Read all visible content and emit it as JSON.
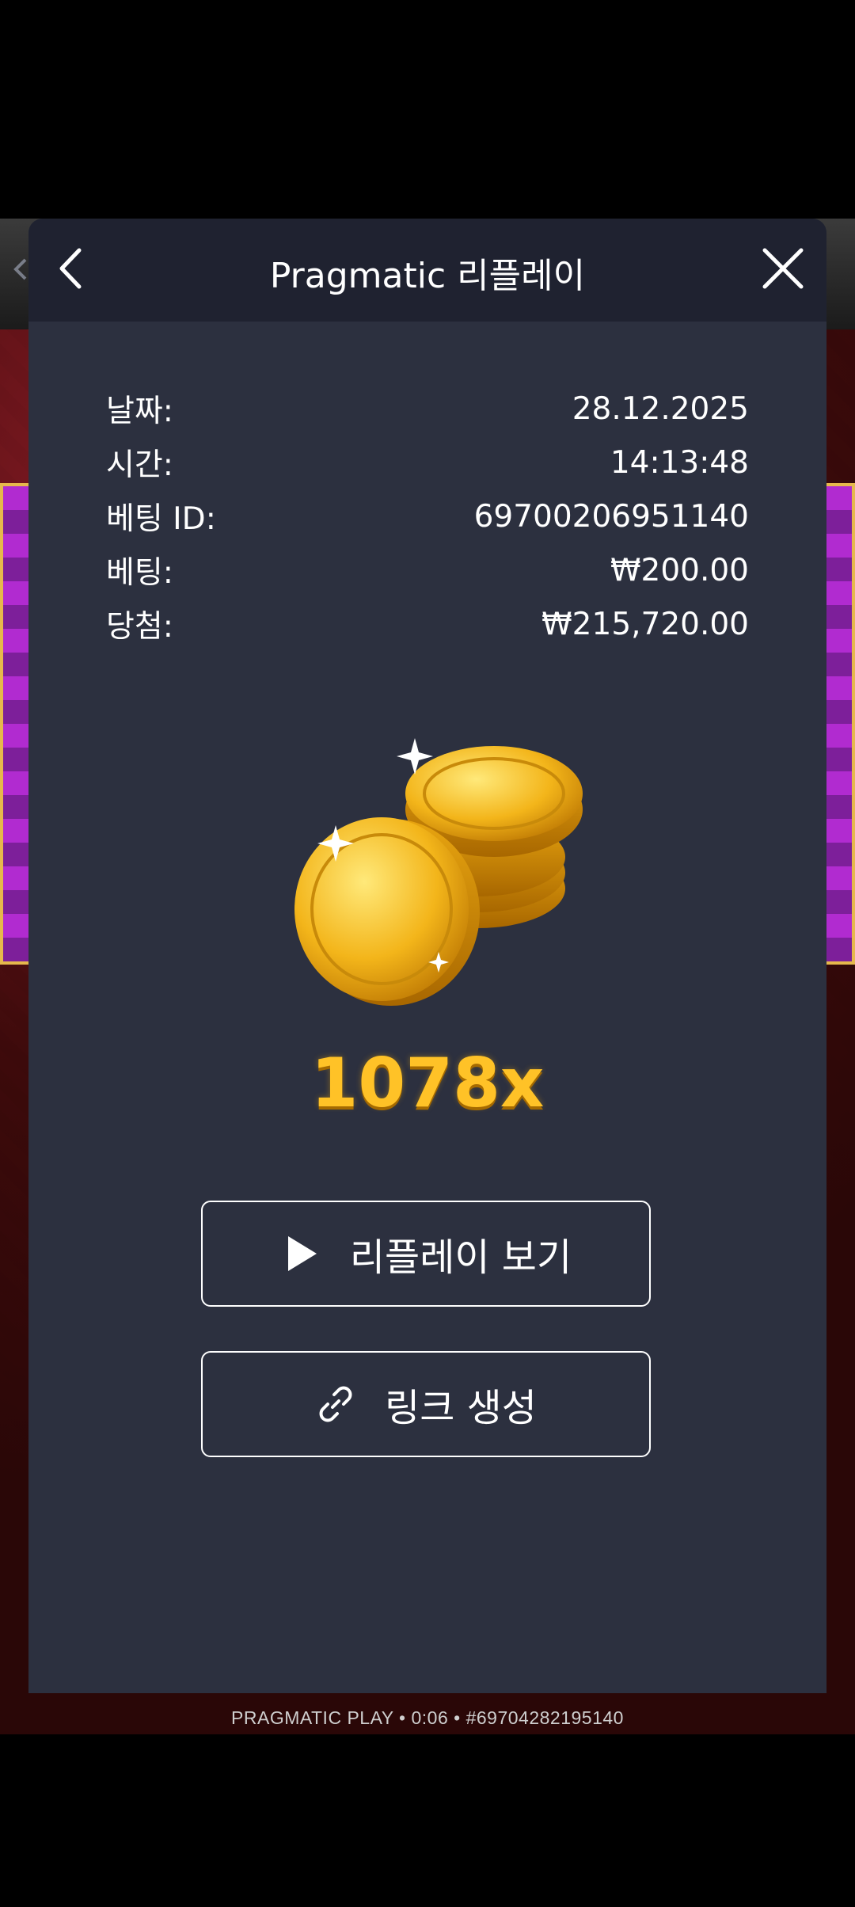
{
  "header": {
    "title": "Pragmatic 리플레이"
  },
  "bet_info": [
    {
      "label": "날짜:",
      "value": "28.12.2025"
    },
    {
      "label": "시간:",
      "value": "14:13:48"
    },
    {
      "label": "베팅 ID:",
      "value": "69700206951140"
    },
    {
      "label": "베팅:",
      "value": "₩200.00"
    },
    {
      "label": "당첨:",
      "value": "₩215,720.00"
    }
  ],
  "multiplier": "1078x",
  "buttons": {
    "replay": "리플레이 보기",
    "link": "링크 생성"
  },
  "footer": "PRAGMATIC PLAY • 0:06 • #69704282195140",
  "colors": {
    "modal_bg": "#2c303f",
    "header_bg": "#1f2230",
    "multiplier": "#ffc227"
  },
  "icons": [
    "back-chevron-icon",
    "close-icon",
    "play-icon",
    "link-icon",
    "gold-coins-icon"
  ]
}
